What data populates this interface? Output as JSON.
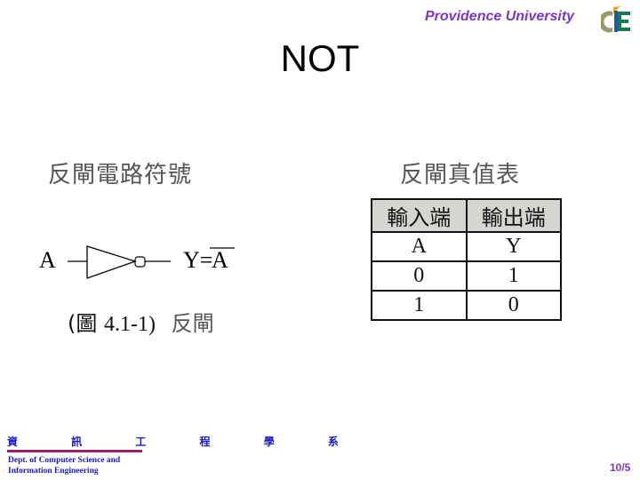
{
  "header": {
    "university": "Providence University",
    "logo_icon": "university-logo-icon",
    "colors": {
      "brand_purple": "#7b35c9",
      "logo_green": "#1a7a4c",
      "logo_olive": "#9a9a6a",
      "logo_flame": "#f0a030"
    }
  },
  "slide": {
    "title": "NOT",
    "left_section": {
      "heading": "反閘電路符號",
      "diagram": {
        "input_label": "A",
        "output_label": "Y=",
        "output_overbar_var": "A"
      },
      "caption_prefix": "(圖",
      "caption_number": "4.1-1)",
      "caption_label": "反閘"
    },
    "right_section": {
      "heading": "反閘真值表",
      "table": {
        "headers": [
          "輸入端",
          "輸出端"
        ],
        "rows": [
          [
            "A",
            "Y"
          ],
          [
            "0",
            "1"
          ],
          [
            "1",
            "0"
          ]
        ]
      }
    }
  },
  "footer": {
    "dept_cn": "資 訊 工 程 學 系",
    "dept_en_line1": "Dept. of Computer Science and",
    "dept_en_line2": "Information Engineering",
    "page_number": "10/5",
    "colors": {
      "dept_blue": "#1a1acc",
      "rule": "#a0206a"
    }
  }
}
